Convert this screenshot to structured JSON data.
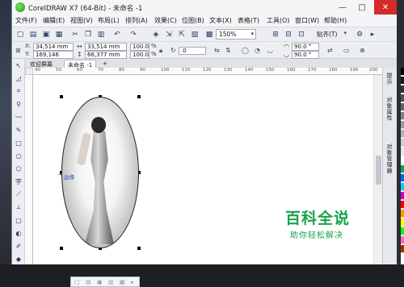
{
  "window": {
    "title": "CorelDRAW X7 (64-Bit) - 未命名 -1",
    "minimize": "—",
    "restore": "□",
    "close": "✕"
  },
  "menu": [
    "文件(F)",
    "编辑(E)",
    "视图(V)",
    "布局(L)",
    "排列(A)",
    "效果(C)",
    "位图(B)",
    "文本(X)",
    "表格(T)",
    "工具(O)",
    "窗口(W)",
    "帮助(H)"
  ],
  "toolbar": {
    "zoom": "150%",
    "snap": "贴齐(T)"
  },
  "property_bar": {
    "x_label": "X:",
    "x_value": "34,514 mm",
    "y_label": "Y:",
    "y_value": "169,146 mm",
    "w_value": "33,514 mm",
    "h_value": "66,377 mm",
    "scale_w": "100.0",
    "scale_h": "100.0",
    "percent": "%",
    "rotation": ".0",
    "angle1": "90.0 °",
    "angle2": "90.0 °"
  },
  "tabs": {
    "welcome": "欢迎屏幕",
    "doc": "未命名 -1",
    "add": "+"
  },
  "ruler_labels": [
    "40",
    "50",
    "60",
    "70",
    "80",
    "90",
    "100",
    "110",
    "120",
    "130",
    "140",
    "150",
    "160",
    "170",
    "180",
    "190",
    "200"
  ],
  "canvas": {
    "edge_label": "边缘"
  },
  "dock_tabs": [
    "提示",
    "对象属性",
    "对象管理器"
  ],
  "palette_colors": [
    "#000000",
    "#1a1a1a",
    "#333333",
    "#4d4d4d",
    "#666666",
    "#808080",
    "#999999",
    "#b3b3b3",
    "#cccccc",
    "#e6e6e6",
    "#ffffff",
    "#00a651",
    "#0066ff",
    "#00ccff",
    "#cc00cc",
    "#ff0000",
    "#ff9900",
    "#ffff00",
    "#00ff00",
    "#ff66cc",
    "#993300"
  ],
  "watermark": {
    "main": "百科全说",
    "sub": "助你轻松解决"
  }
}
